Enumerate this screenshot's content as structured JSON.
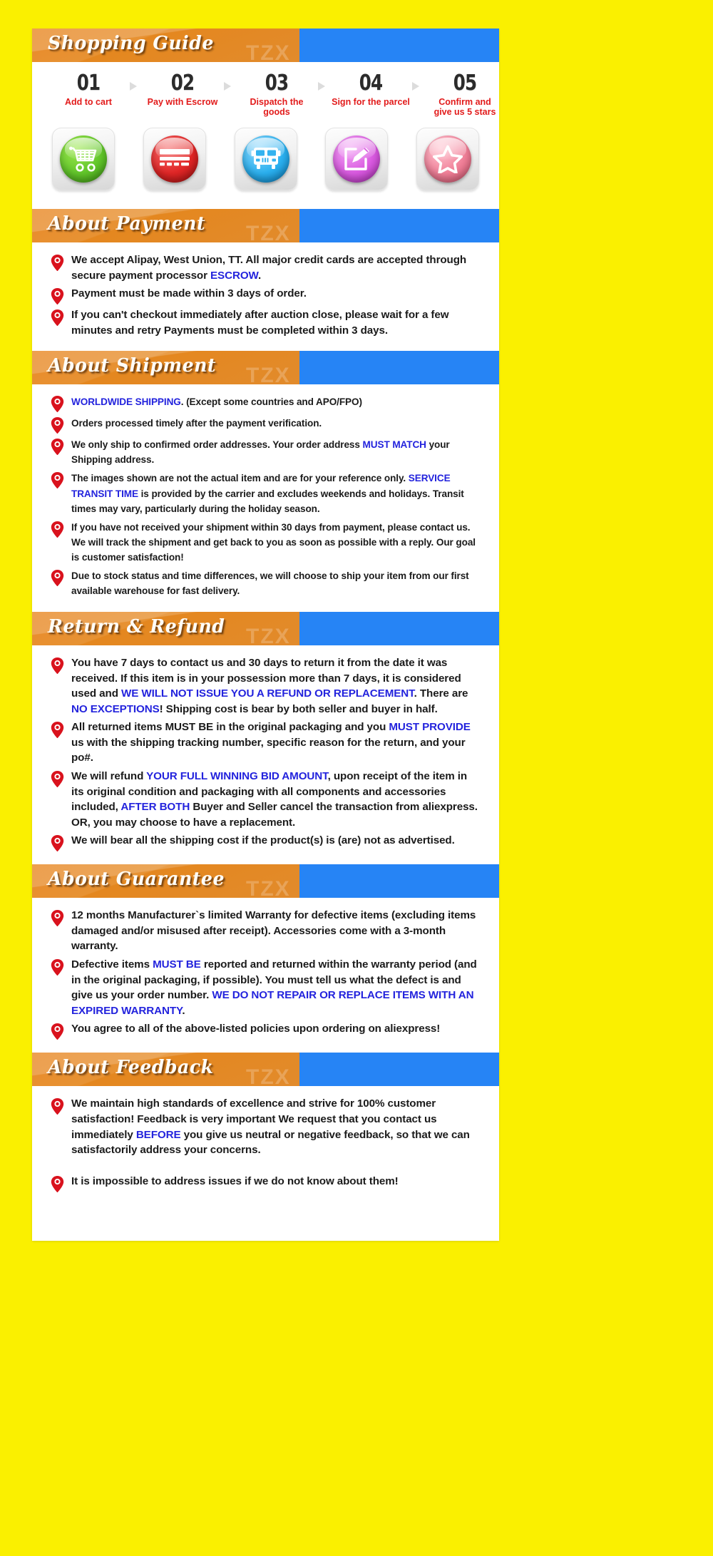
{
  "theme": {
    "page_background": "#faf000",
    "banner_blue": "#2684f5",
    "banner_orange": "#e28b2c",
    "highlight_blue": "#2323dd",
    "step_label_red": "#e21b1b",
    "watermark": "TZX"
  },
  "guide": {
    "title": "Shopping Guide",
    "steps": [
      {
        "num": "01",
        "label": "Add to cart",
        "icon": "shopping-cart-icon",
        "orb": "orb-green"
      },
      {
        "num": "02",
        "label": "Pay with Escrow",
        "icon": "credit-card-icon",
        "orb": "orb-red"
      },
      {
        "num": "03",
        "label": "Dispatch the goods",
        "icon": "delivery-truck-icon",
        "orb": "orb-blue"
      },
      {
        "num": "04",
        "label": "Sign for the parcel",
        "icon": "sign-document-icon",
        "orb": "orb-purple"
      },
      {
        "num": "05",
        "label": "Confirm and\ngive us 5 stars",
        "icon": "star-icon",
        "orb": "orb-pink"
      }
    ]
  },
  "payment": {
    "title": "About Payment",
    "items": [
      [
        {
          "t": "We accept Alipay, West Union, TT. All major credit cards are accepted through secure payment processor "
        },
        {
          "t": "ESCROW",
          "hl": true
        },
        {
          "t": "."
        }
      ],
      [
        {
          "t": "Payment must be made within 3 days of order."
        }
      ],
      [
        {
          "t": "If you can't checkout immediately after auction close, please wait for a few minutes and retry Payments must be completed within 3 days."
        }
      ]
    ]
  },
  "shipment": {
    "title": "About Shipment",
    "items": [
      [
        {
          "t": "WORLDWIDE SHIPPING",
          "hl": true
        },
        {
          "t": ". (Except some countries and APO/FPO)"
        }
      ],
      [
        {
          "t": "Orders processed timely after the payment verification."
        }
      ],
      [
        {
          "t": "We only ship to confirmed order addresses. Your order address "
        },
        {
          "t": "MUST MATCH",
          "hl": true
        },
        {
          "t": " your Shipping address."
        }
      ],
      [
        {
          "t": "The images shown are not the actual item and are for your reference only. "
        },
        {
          "t": "SERVICE TRANSIT TIME",
          "hl": true
        },
        {
          "t": " is provided by the carrier and excludes weekends and holidays. Transit times may vary, particularly during the holiday season."
        }
      ],
      [
        {
          "t": "If you have not received your shipment within 30 days from payment, please contact us. We will track the shipment and get back to you as soon as possible with a reply. Our goal is customer satisfaction!"
        }
      ],
      [
        {
          "t": "Due to stock status and time differences, we will choose to ship your item from our first available warehouse for fast delivery."
        }
      ]
    ]
  },
  "return_refund": {
    "title": "Return & Refund",
    "items": [
      [
        {
          "t": "You have 7 days to contact us and 30 days to return it from the date it was received. If this item is in your possession more than 7 days, it is considered used and "
        },
        {
          "t": "WE WILL NOT ISSUE YOU A REFUND OR REPLACEMENT",
          "hl": true
        },
        {
          "t": ". There are "
        },
        {
          "t": "NO EXCEPTIONS",
          "hl": true
        },
        {
          "t": "! Shipping cost is bear by both seller and buyer in half."
        }
      ],
      [
        {
          "t": "All returned items MUST BE in the original packaging and you "
        },
        {
          "t": "MUST PROVIDE",
          "hl": true
        },
        {
          "t": " us with the shipping tracking number, specific reason for the  return, and your po#."
        }
      ],
      [
        {
          "t": "We will refund "
        },
        {
          "t": "YOUR FULL WINNING BID AMOUNT",
          "hl": true
        },
        {
          "t": ", upon receipt of the item in its original condition and packaging with all components and accessories included, "
        },
        {
          "t": "AFTER BOTH",
          "hl": true
        },
        {
          "t": " Buyer and Seller cancel the transaction from aliexpress. OR, you may choose to have a replacement."
        }
      ],
      [
        {
          "t": "We will bear all the shipping cost if the product(s) is (are) not as advertised."
        }
      ]
    ]
  },
  "guarantee": {
    "title": "About Guarantee",
    "items": [
      [
        {
          "t": "12 months Manufacturer`s limited Warranty for defective items (excluding  items damaged and/or misused after receipt). Accessories come with a 3-month warranty."
        }
      ],
      [
        {
          "t": "Defective items "
        },
        {
          "t": "MUST BE",
          "hl": true
        },
        {
          "t": " reported and returned within the warranty period (and in the original packaging, if possible). You must tell us what the defect is and give us your order number. "
        },
        {
          "t": "WE DO NOT REPAIR OR REPLACE ITEMS WITH AN EXPIRED WARRANTY",
          "hl": true
        },
        {
          "t": "."
        }
      ],
      [
        {
          "t": "You agree to all of the above-listed policies upon ordering on aliexpress!"
        }
      ]
    ]
  },
  "feedback": {
    "title": "About Feedback",
    "items": [
      [
        {
          "t": "We maintain high standards of excellence and strive for 100% customer satisfaction! Feedback is very important We request that you contact us immediately "
        },
        {
          "t": "BEFORE",
          "hl": true
        },
        {
          "t": " you give us neutral or negative feedback, so that we can satisfactorily address your concerns."
        }
      ],
      [
        {
          "t": "It is impossible to address issues if we do not know about them!"
        }
      ]
    ]
  }
}
